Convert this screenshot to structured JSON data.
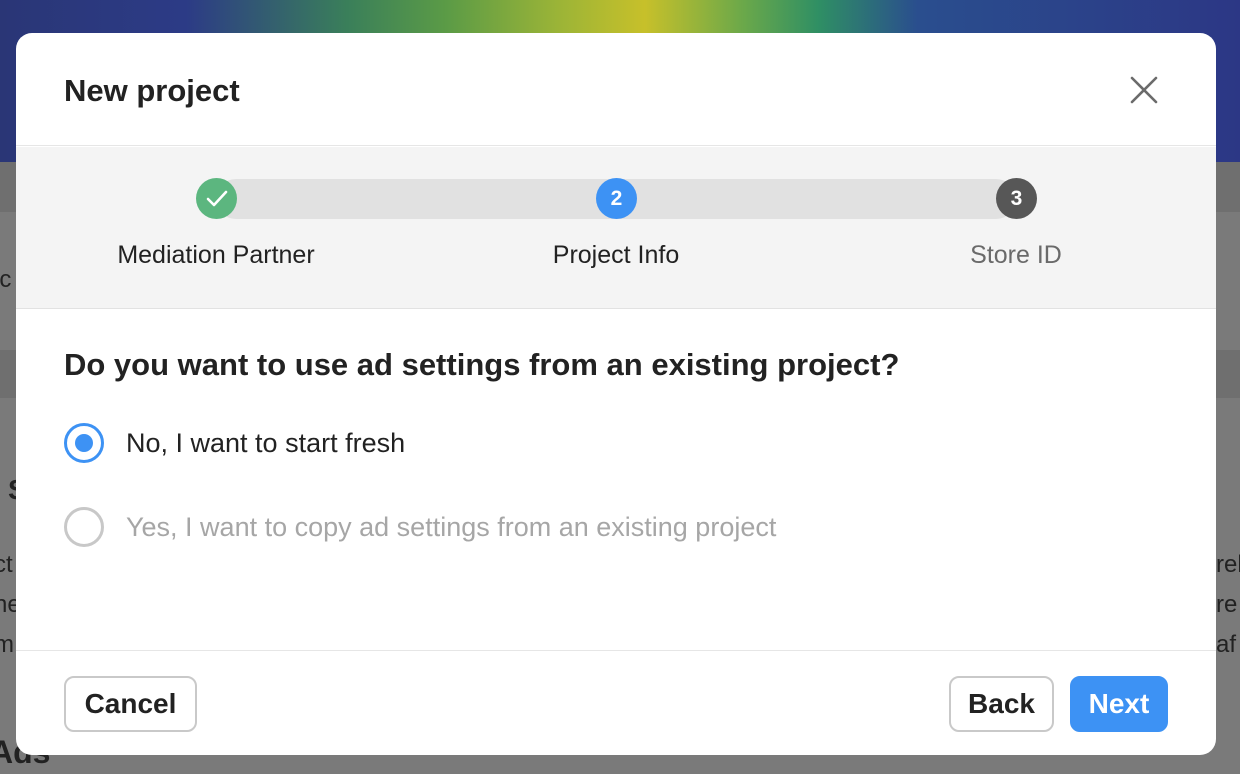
{
  "background": {
    "fragments": [
      "ic",
      "S",
      "ct",
      "he",
      "m",
      "rel",
      "re",
      "af",
      "Ads"
    ]
  },
  "modal": {
    "title": "New project",
    "close_icon": "close-icon",
    "steps": [
      {
        "number": "",
        "label": "Mediation Partner",
        "status": "complete",
        "icon": "checkmark-icon"
      },
      {
        "number": "2",
        "label": "Project Info",
        "status": "active"
      },
      {
        "number": "3",
        "label": "Store ID",
        "status": "upcoming"
      }
    ],
    "question": "Do you want to use ad settings from an existing project?",
    "options": [
      {
        "label": "No, I want to start fresh",
        "checked": true
      },
      {
        "label": "Yes, I want to copy ad settings from an existing project",
        "checked": false
      }
    ],
    "footer": {
      "cancel_label": "Cancel",
      "back_label": "Back",
      "next_label": "Next"
    }
  },
  "colors": {
    "accent": "#3d92f4",
    "complete": "#5cb67f",
    "upcoming": "#575757"
  }
}
